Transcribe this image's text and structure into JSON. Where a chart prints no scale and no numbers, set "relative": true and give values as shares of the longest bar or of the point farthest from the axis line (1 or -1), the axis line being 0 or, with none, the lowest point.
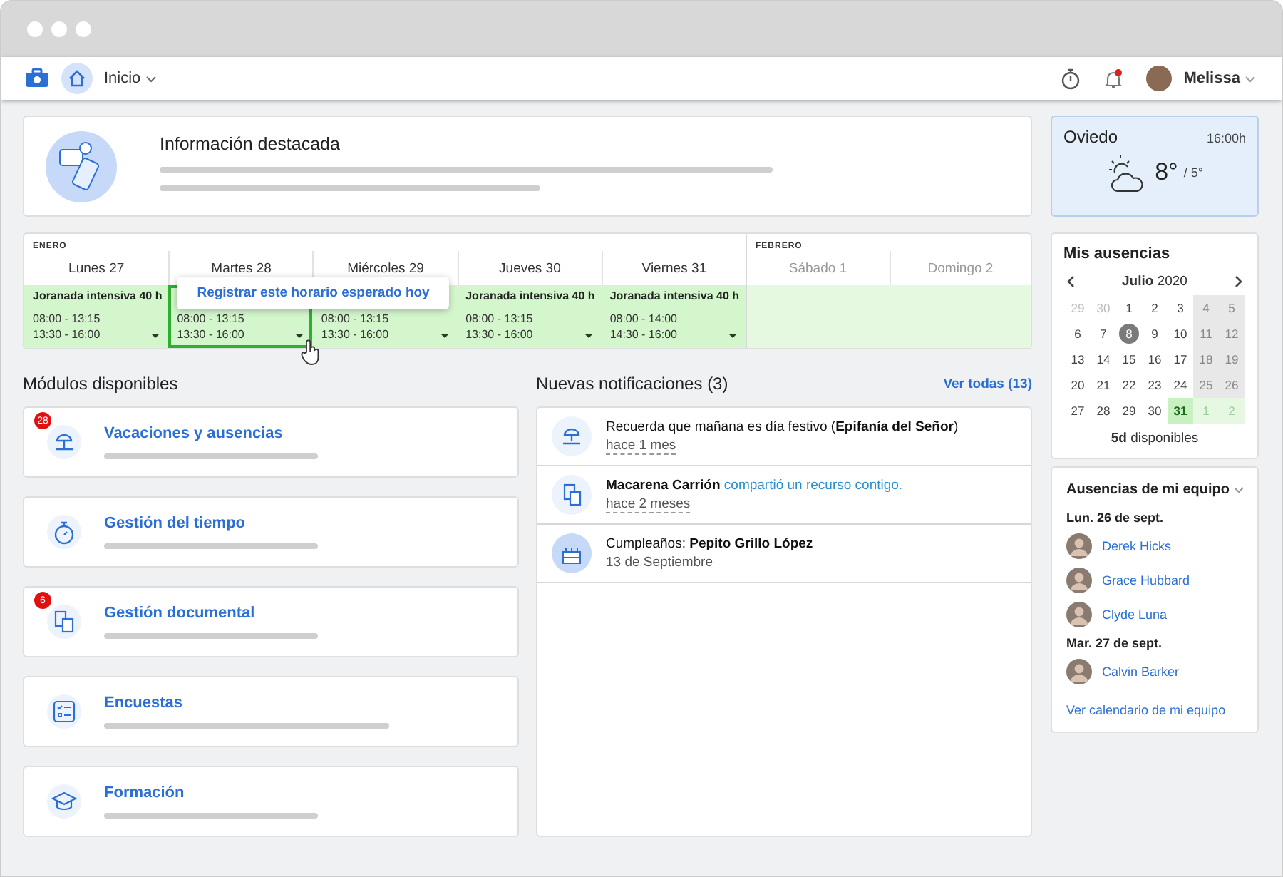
{
  "topbar": {
    "home_label": "Inicio",
    "has_alert": true,
    "user": "Melissa"
  },
  "featured": {
    "title": "Información destacada"
  },
  "weather": {
    "city": "Oviedo",
    "time": "16:00h",
    "temp": "8°",
    "low": "/ 5°"
  },
  "schedule": {
    "tooltip": "Registrar este horario esperado hoy",
    "months": [
      {
        "name": "ENERO",
        "days": [
          {
            "label": "Lunes 27",
            "weekend": false,
            "selected": false,
            "shift": {
              "title": "Joranada intensiva 40 h",
              "times": [
                "08:00 - 13:15",
                "13:30 - 16:00"
              ]
            }
          },
          {
            "label": "Martes 28",
            "weekend": false,
            "selected": true,
            "shift": {
              "times": [
                "08:00 - 13:15",
                "13:30 - 16:00"
              ]
            }
          },
          {
            "label": "Miércoles 29",
            "weekend": false,
            "selected": false,
            "shift": {
              "times": [
                "08:00 - 13:15",
                "13:30 - 16:00"
              ]
            }
          },
          {
            "label": "Jueves 30",
            "weekend": false,
            "selected": false,
            "shift": {
              "title": "Joranada intensiva 40 h",
              "times": [
                "08:00 - 13:15",
                "13:30 - 16:00"
              ]
            }
          },
          {
            "label": "Viernes 31",
            "weekend": false,
            "selected": false,
            "shift": {
              "title": "Joranada intensiva 40 h",
              "times": [
                "08:00 - 14:00",
                "14:30 - 16:00"
              ]
            }
          }
        ]
      },
      {
        "name": "FEBRERO",
        "days": [
          {
            "label": "Sábado 1",
            "weekend": true,
            "selected": false
          },
          {
            "label": "Domingo 2",
            "weekend": true,
            "selected": false
          }
        ]
      }
    ]
  },
  "modules": {
    "title": "Módulos disponibles",
    "items": [
      {
        "name": "Vacaciones y ausencias",
        "kind": "beach",
        "badge": "28"
      },
      {
        "name": "Gestión del tiempo",
        "kind": "timer"
      },
      {
        "name": "Gestión documental",
        "kind": "docs",
        "badge": "6"
      },
      {
        "name": "Encuestas",
        "kind": "survey"
      },
      {
        "name": "Formación",
        "kind": "cap"
      }
    ]
  },
  "notifications": {
    "title": "Nuevas notificaciones (3)",
    "see_all": "Ver todas (13)",
    "items": [
      {
        "kind": "beach",
        "text": "Recuerda que mañana es día festivo (**Epifanía del Señor**)",
        "time": "hace 1 mes",
        "relative": true
      },
      {
        "kind": "docs",
        "actor": "Macarena Carrión",
        "link": "compartió un recurso contigo.",
        "time": "hace 2 meses",
        "relative": true
      },
      {
        "kind": "cake",
        "text": "Cumpleaños: **Pepito Grillo López**",
        "time": "13 de Septiembre",
        "relative": false
      }
    ]
  },
  "absences": {
    "title": "Mis ausencias",
    "month": "Julio",
    "year": "2020",
    "available": "**5d** disponibles",
    "weeks": [
      [
        {
          "d": "29",
          "outside": true,
          "today": false,
          "absence": false
        },
        {
          "d": "30",
          "outside": true,
          "today": false,
          "absence": false
        },
        {
          "d": "1",
          "outside": false,
          "today": false,
          "absence": false
        },
        {
          "d": "2",
          "outside": false,
          "today": false,
          "absence": false
        },
        {
          "d": "3",
          "outside": false,
          "today": false,
          "absence": false
        },
        {
          "d": "4",
          "outside": false,
          "today": false,
          "absence": false
        },
        {
          "d": "5",
          "outside": false,
          "today": false,
          "absence": false
        }
      ],
      [
        {
          "d": "6",
          "outside": false,
          "today": false,
          "absence": false
        },
        {
          "d": "7",
          "outside": false,
          "today": false,
          "absence": false
        },
        {
          "d": "8",
          "outside": false,
          "today": true,
          "absence": false
        },
        {
          "d": "9",
          "outside": false,
          "today": false,
          "absence": false
        },
        {
          "d": "10",
          "outside": false,
          "today": false,
          "absence": false
        },
        {
          "d": "11",
          "outside": false,
          "today": false,
          "absence": false
        },
        {
          "d": "12",
          "outside": false,
          "today": false,
          "absence": false
        }
      ],
      [
        {
          "d": "13",
          "outside": false,
          "today": false,
          "absence": false
        },
        {
          "d": "14",
          "outside": false,
          "today": false,
          "absence": false
        },
        {
          "d": "15",
          "outside": false,
          "today": false,
          "absence": false
        },
        {
          "d": "16",
          "outside": false,
          "today": false,
          "absence": false
        },
        {
          "d": "17",
          "outside": false,
          "today": false,
          "absence": false
        },
        {
          "d": "18",
          "outside": false,
          "today": false,
          "absence": false
        },
        {
          "d": "19",
          "outside": false,
          "today": false,
          "absence": false
        }
      ],
      [
        {
          "d": "20",
          "outside": false,
          "today": false,
          "absence": false
        },
        {
          "d": "21",
          "outside": false,
          "today": false,
          "absence": false
        },
        {
          "d": "22",
          "outside": false,
          "today": false,
          "absence": false
        },
        {
          "d": "23",
          "outside": false,
          "today": false,
          "absence": false
        },
        {
          "d": "24",
          "outside": false,
          "today": false,
          "absence": false
        },
        {
          "d": "25",
          "outside": false,
          "today": false,
          "absence": false
        },
        {
          "d": "26",
          "outside": false,
          "today": false,
          "absence": false
        }
      ],
      [
        {
          "d": "27",
          "outside": false,
          "today": false,
          "absence": false
        },
        {
          "d": "28",
          "outside": false,
          "today": false,
          "absence": false
        },
        {
          "d": "29",
          "outside": false,
          "today": false,
          "absence": false
        },
        {
          "d": "30",
          "outside": false,
          "today": false,
          "absence": false
        },
        {
          "d": "31",
          "outside": false,
          "today": false,
          "absence": true
        },
        {
          "d": "1",
          "outside": true,
          "today": false,
          "absence": true
        },
        {
          "d": "2",
          "outside": true,
          "today": false,
          "absence": true
        }
      ]
    ]
  },
  "team": {
    "title": "Ausencias de mi equipo",
    "link": "Ver calendario de mi equipo",
    "groups": [
      {
        "date": "Lun. 26 de sept.",
        "people": [
          {
            "name": "Derek Hicks"
          },
          {
            "name": "Grace Hubbard"
          },
          {
            "name": "Clyde Luna"
          }
        ]
      },
      {
        "date": "Mar. 27 de sept.",
        "people": [
          {
            "name": "Calvin Barker"
          }
        ]
      }
    ]
  }
}
